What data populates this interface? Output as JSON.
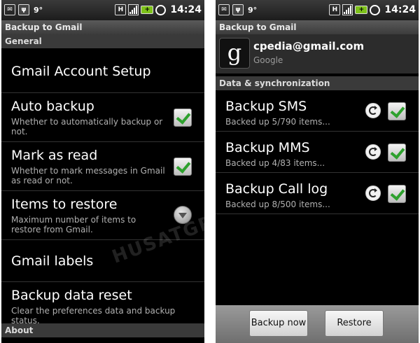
{
  "status": {
    "temperature": "9°",
    "time": "14:24",
    "battery": "+"
  },
  "left": {
    "title": "Backup to Gmail",
    "section_general": "General",
    "items": [
      {
        "title": "Gmail Account Setup"
      },
      {
        "title": "Auto backup",
        "subtitle": "Whether to automatically backup or not.",
        "checked": true
      },
      {
        "title": "Mark as read",
        "subtitle": "Whether to mark messages in Gmail as read or not.",
        "checked": true
      },
      {
        "title": "Items to restore",
        "subtitle": "Maximum number of items to restore from Gmail."
      },
      {
        "title": "Gmail labels"
      },
      {
        "title": "Backup data reset",
        "subtitle": "Clear the preferences data and backup status."
      }
    ],
    "section_about": "About"
  },
  "right": {
    "title": "Backup to Gmail",
    "account": {
      "email": "cpedia@gmail.com",
      "type": "Google",
      "logo_letter": "g"
    },
    "section_sync": "Data & synchronization",
    "items": [
      {
        "title": "Backup SMS",
        "subtitle": "Backed up 5/790 items...",
        "checked": true
      },
      {
        "title": "Backup MMS",
        "subtitle": "Backed up 4/83 items...",
        "checked": true
      },
      {
        "title": "Backup Call log",
        "subtitle": "Backed up 8/500 items...",
        "checked": true
      }
    ],
    "buttons": {
      "backup_now": "Backup now",
      "restore": "Restore"
    }
  },
  "watermark": "HUSATGRAFIX.COM",
  "colors": {
    "check_green": "#2ea12e",
    "battery_green": "#7ec21a",
    "background": "#000000"
  }
}
